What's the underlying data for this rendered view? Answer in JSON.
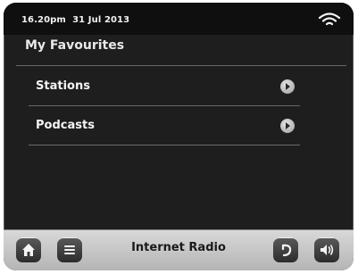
{
  "status": {
    "time": "16.20pm",
    "date": "31 Jul 2013",
    "wifi_icon": "wifi-icon"
  },
  "page": {
    "title": "My Favourites"
  },
  "list": {
    "items": [
      {
        "label": "Stations",
        "icon": "chevron-right-icon"
      },
      {
        "label": "Podcasts",
        "icon": "chevron-right-icon"
      }
    ]
  },
  "bottombar": {
    "title": "Internet Radio",
    "home_icon": "home-icon",
    "menu_icon": "menu-icon",
    "back_icon": "back-icon",
    "volume_icon": "volume-icon"
  },
  "colors": {
    "screen": "#1e1e1e",
    "statusbar": "#0f0f0f",
    "bottombar": "#c8c8c8",
    "text": "#f4f4f4"
  }
}
